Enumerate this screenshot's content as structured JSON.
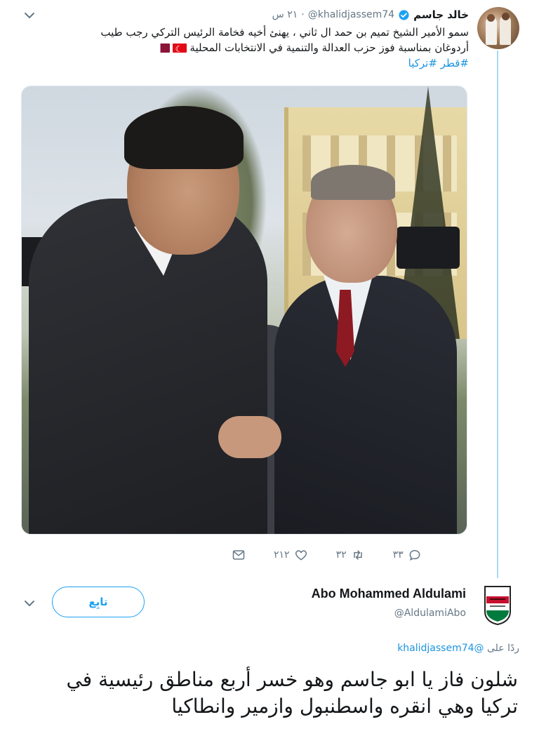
{
  "colors": {
    "accent": "#1da1f2",
    "link": "#1b95e0",
    "muted": "#657786",
    "thread_line": "#aad8f2"
  },
  "tweet": {
    "display_name": "خالد جاسم",
    "verified": "verified-badge-icon",
    "handle": "@khalidjassem74",
    "separator": "·",
    "timestamp": "٢١ س",
    "text_line1": "سمو الأمير الشيخ تميم بن حمد ال ثاني ، يهنئ أخيه فخامة الرئيس التركي رجب طيب",
    "text_line2": "أردوغان بمناسبة فوز حزب العدالة والتنمية في الانتخابات المحلية",
    "hashtags": "#قطر #تركيا",
    "flags": [
      "turkey-flag",
      "qatar-flag"
    ],
    "actions": {
      "replies": "٣٣",
      "retweets": "٣٢",
      "likes": "٢١٢"
    }
  },
  "reply": {
    "display_name": "Abo Mohammed Aldulami",
    "handle": "@AldulamiAbo",
    "follow_label": "تابِع",
    "replying_prefix": "ردًا على",
    "replying_to": "@khalidjassem74",
    "text": "شلون فاز يا ابو جاسم وهو خسر أربع مناطق رئيسية في تركيا وهي انقره واسطنبول وازمير وانطاكيا"
  }
}
